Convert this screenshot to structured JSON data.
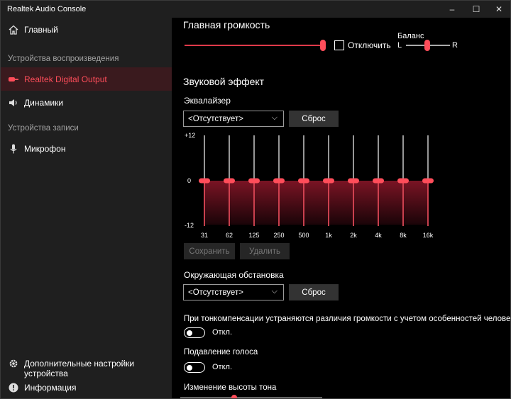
{
  "window": {
    "title": "Realtek Audio Console",
    "minimize": "–",
    "maximize": "☐",
    "close": "✕"
  },
  "sidebar": {
    "home": "Главный",
    "playback_header": "Устройства воспроизведения",
    "playback": [
      {
        "label": "Realtek Digital Output",
        "icon": "digital-output-icon",
        "selected": true
      },
      {
        "label": "Динамики",
        "icon": "speaker-icon",
        "selected": false
      }
    ],
    "recording_header": "Устройства записи",
    "recording": [
      {
        "label": "Микрофон",
        "icon": "microphone-icon"
      }
    ],
    "advanced": "Дополнительные настройки устройства",
    "info": "Информация"
  },
  "main": {
    "volume_title": "Главная громкость",
    "volume_level": 1.0,
    "mute_label": "Отключить",
    "mute_checked": false,
    "balance_label": "Баланс",
    "balance_left": "L",
    "balance_right": "R",
    "balance_value": 0.5,
    "sound_effect_title": "Звуковой эффект",
    "equalizer_title": "Эквалайзер",
    "equalizer_preset": "<Отсутствует>",
    "reset_label": "Сброс",
    "eq_scale": {
      "top": "+12",
      "mid": "0",
      "bottom": "-12"
    },
    "eq_bands": [
      {
        "freq": "31",
        "gain": 0
      },
      {
        "freq": "62",
        "gain": 0
      },
      {
        "freq": "125",
        "gain": 0
      },
      {
        "freq": "250",
        "gain": 0
      },
      {
        "freq": "500",
        "gain": 0
      },
      {
        "freq": "1k",
        "gain": 0
      },
      {
        "freq": "2k",
        "gain": 0
      },
      {
        "freq": "4k",
        "gain": 0
      },
      {
        "freq": "8k",
        "gain": 0
      },
      {
        "freq": "16k",
        "gain": 0
      }
    ],
    "save_label": "Сохранить",
    "delete_label": "Удалить",
    "environment_title": "Окружающая обстановка",
    "environment_preset": "<Отсутствует>",
    "environment_reset": "Сброс",
    "loudness_text": "При тонкомпенсации устраняются различия громкости с учетом особенностей человеческого",
    "loudness_state": "Откл.",
    "voice_suppression_title": "Подавление голоса",
    "voice_suppression_state": "Откл.",
    "pitch_title": "Изменение высоты тона"
  },
  "colors": {
    "accent": "#ff4d5a",
    "sidebar_bg": "#1f1f1f",
    "selected_bg": "#3a1a1e"
  }
}
